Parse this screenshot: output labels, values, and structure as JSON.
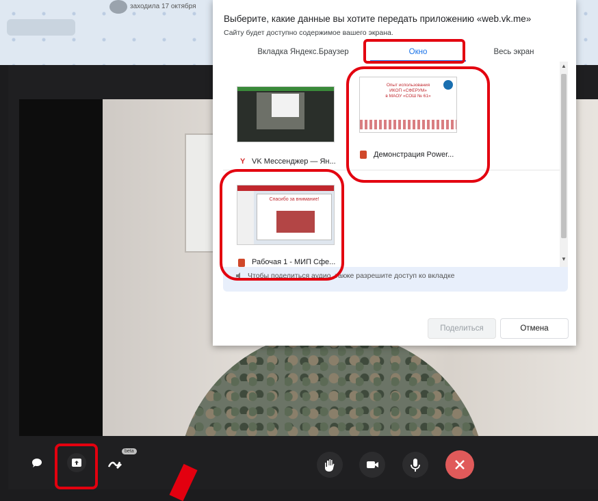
{
  "background": {
    "status_text": "заходила 17 октября"
  },
  "dialog": {
    "title": "Выберите, какие данные вы хотите передать приложению «web.vk.me»",
    "subtitle": "Сайту будет доступно содержимое вашего экрана.",
    "tabs": [
      {
        "label": "Вкладка Яндекс.Браузер"
      },
      {
        "label": "Окно"
      },
      {
        "label": "Весь экран"
      }
    ],
    "selected_tab": "Окно",
    "windows": [
      {
        "label": "VK Мессенджер — Ян..."
      },
      {
        "label": "Демонстрация Power...",
        "preview_text": [
          "Опыт использования",
          "ИКОП «СФЕРУМ»",
          "в МАОУ «СОШ № 61»"
        ]
      },
      {
        "label": "Рабочая 1 - МИП Сфе...",
        "preview_text": "Спасибо за внимание!"
      }
    ],
    "audio_note": "Чтобы поделиться аудио, также разрешите доступ ко вкладке",
    "share_button": "Поделиться",
    "cancel_button": "Отмена"
  },
  "controls": {
    "beta_badge": "beta"
  },
  "colors": {
    "accent": "#1a73e8",
    "annotation": "#e3000f",
    "end_call": "#e05a5a"
  }
}
